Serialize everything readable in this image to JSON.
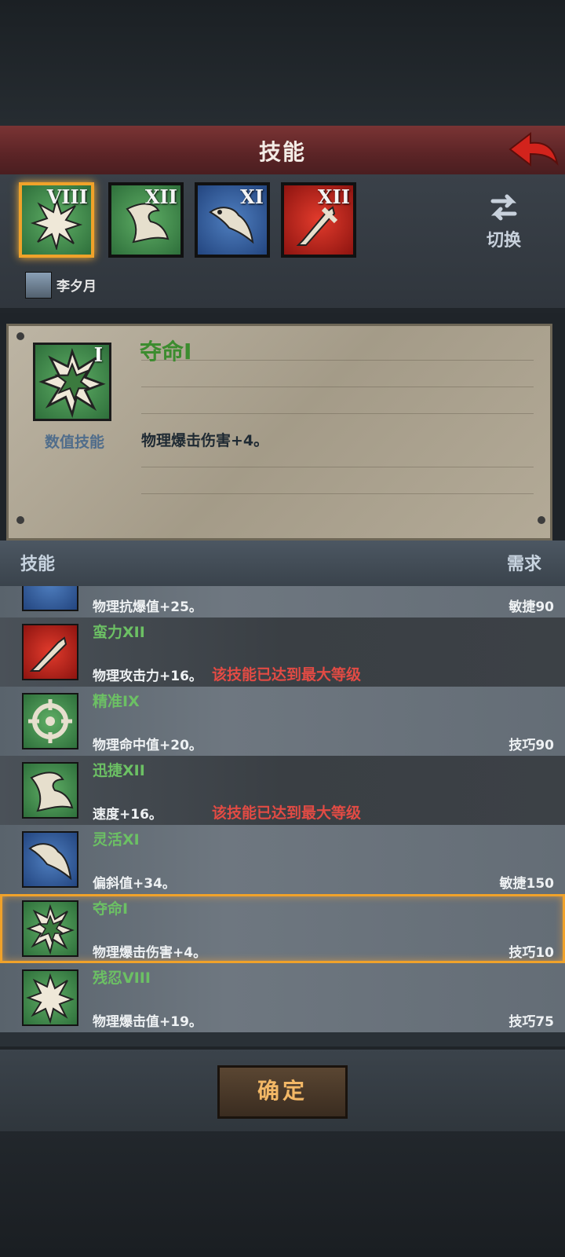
{
  "header": {
    "title": "技能"
  },
  "tabs": [
    {
      "level": "VIII",
      "color": "green",
      "icon": "burst-icon",
      "selected": true
    },
    {
      "level": "XII",
      "color": "green",
      "icon": "wing-icon",
      "selected": false
    },
    {
      "level": "XI",
      "color": "blue",
      "icon": "feather-icon",
      "selected": false
    },
    {
      "level": "XII",
      "color": "red",
      "icon": "sword-icon",
      "selected": false
    }
  ],
  "switch": {
    "label": "切换"
  },
  "character": {
    "name": "李夕月"
  },
  "detail": {
    "level": "I",
    "type_label": "数值技能",
    "name": "夺命I",
    "description": "物理爆击伤害+4。"
  },
  "list_header": {
    "left": "技能",
    "right": "需求"
  },
  "rows": [
    {
      "name": "",
      "desc": "物理抗爆值+25。",
      "req": "敏捷90",
      "max": "",
      "color": "blue",
      "icon": "wing-icon"
    },
    {
      "name": "蛮力XII",
      "desc": "物理攻击力+16。",
      "req": "",
      "max": "该技能已达到最大等级",
      "color": "red",
      "icon": "sword-icon"
    },
    {
      "name": "精准IX",
      "desc": "物理命中值+20。",
      "req": "技巧90",
      "max": "",
      "color": "green",
      "icon": "target-icon"
    },
    {
      "name": "迅捷XII",
      "desc": "速度+16。",
      "req": "",
      "max": "该技能已达到最大等级",
      "color": "green",
      "icon": "wing-icon"
    },
    {
      "name": "灵活XI",
      "desc": "偏斜值+34。",
      "req": "敏捷150",
      "max": "",
      "color": "blue",
      "icon": "feather-icon"
    },
    {
      "name": "夺命I",
      "desc": "物理爆击伤害+4。",
      "req": "技巧10",
      "max": "",
      "color": "green",
      "icon": "burst-icon",
      "selected": true
    },
    {
      "name": "残忍VIII",
      "desc": "物理爆击值+19。",
      "req": "技巧75",
      "max": "",
      "color": "green",
      "icon": "burst-icon"
    }
  ],
  "confirm": {
    "label": "确定"
  }
}
